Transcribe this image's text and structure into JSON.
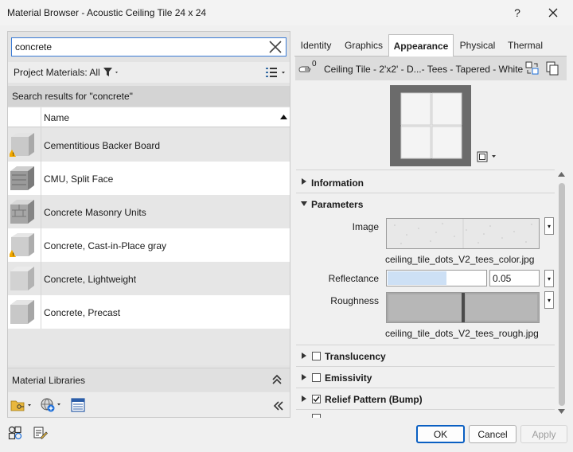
{
  "window": {
    "title": "Material Browser - Acoustic Ceiling Tile 24 x 24",
    "help_label": "?",
    "close_label": "✕"
  },
  "search": {
    "value": "concrete",
    "placeholder": ""
  },
  "project_materials": {
    "label": "Project Materials: All"
  },
  "results": {
    "header": "Search results for \"concrete\"",
    "column_name": "Name",
    "items": [
      {
        "name": "Cementitious Backer Board",
        "warning": true
      },
      {
        "name": "CMU, Split Face",
        "warning": false
      },
      {
        "name": "Concrete Masonry Units",
        "warning": false
      },
      {
        "name": "Concrete, Cast-in-Place gray",
        "warning": true
      },
      {
        "name": "Concrete, Lightweight",
        "warning": false
      },
      {
        "name": "Concrete, Precast",
        "warning": false
      }
    ]
  },
  "libraries": {
    "label": "Material Libraries"
  },
  "tabs": [
    {
      "label": "Identity",
      "active": false
    },
    {
      "label": "Graphics",
      "active": false
    },
    {
      "label": "Appearance",
      "active": true
    },
    {
      "label": "Physical",
      "active": false
    },
    {
      "label": "Thermal",
      "active": false
    }
  ],
  "asset": {
    "name": "Ceiling Tile - 2'x2' - D...- Tees - Tapered - White",
    "usage_count": "0"
  },
  "sections": {
    "information": "Information",
    "parameters": "Parameters",
    "translucency": "Translucency",
    "emissivity": "Emissivity",
    "relief": "Relief Pattern (Bump)"
  },
  "parameters": {
    "image_label": "Image",
    "image_file": "ceiling_tile_dots_V2_tees_color.jpg",
    "reflectance_label": "Reflectance",
    "reflectance_value": "0.05",
    "reflectance_fill": 0.6,
    "roughness_label": "Roughness",
    "roughness_file": "ceiling_tile_dots_V2_tees_rough.jpg"
  },
  "checks": {
    "translucency": false,
    "emissivity": false,
    "relief": true
  },
  "buttons": {
    "ok": "OK",
    "cancel": "Cancel",
    "apply": "Apply"
  },
  "colors": {
    "accent": "#0a5fc2",
    "search_border": "#3a7bd5",
    "warning": "#f2a900",
    "reflectance_bar": "#cde0f5"
  }
}
